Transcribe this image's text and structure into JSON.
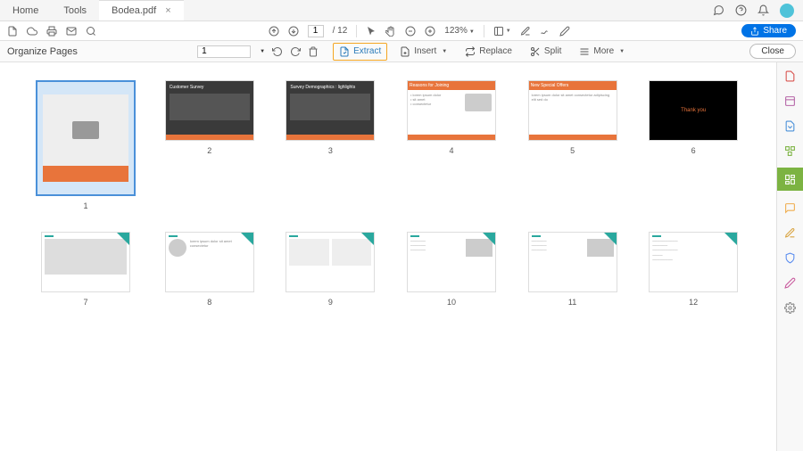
{
  "tabs": {
    "home": "Home",
    "tools": "Tools",
    "file": "Bodea.pdf"
  },
  "toolbar": {
    "page_current": "1",
    "page_total": "/ 12",
    "zoom": "123%",
    "share": "Share"
  },
  "organize": {
    "title": "Organize Pages",
    "page_select": "1",
    "extract": "Extract",
    "insert": "Insert",
    "replace": "Replace",
    "split": "Split",
    "more": "More",
    "close": "Close"
  },
  "pages": [
    {
      "num": "1"
    },
    {
      "num": "2"
    },
    {
      "num": "3"
    },
    {
      "num": "4"
    },
    {
      "num": "5"
    },
    {
      "num": "6"
    },
    {
      "num": "7"
    },
    {
      "num": "8"
    },
    {
      "num": "9"
    },
    {
      "num": "10"
    },
    {
      "num": "11"
    },
    {
      "num": "12"
    }
  ],
  "slides_text": {
    "s2": "Customer Survey",
    "s3": "Survey Demographics : lighlights",
    "s4": "Reasons for Joining",
    "s5": "New Special Offers",
    "s6": "Thank you"
  }
}
